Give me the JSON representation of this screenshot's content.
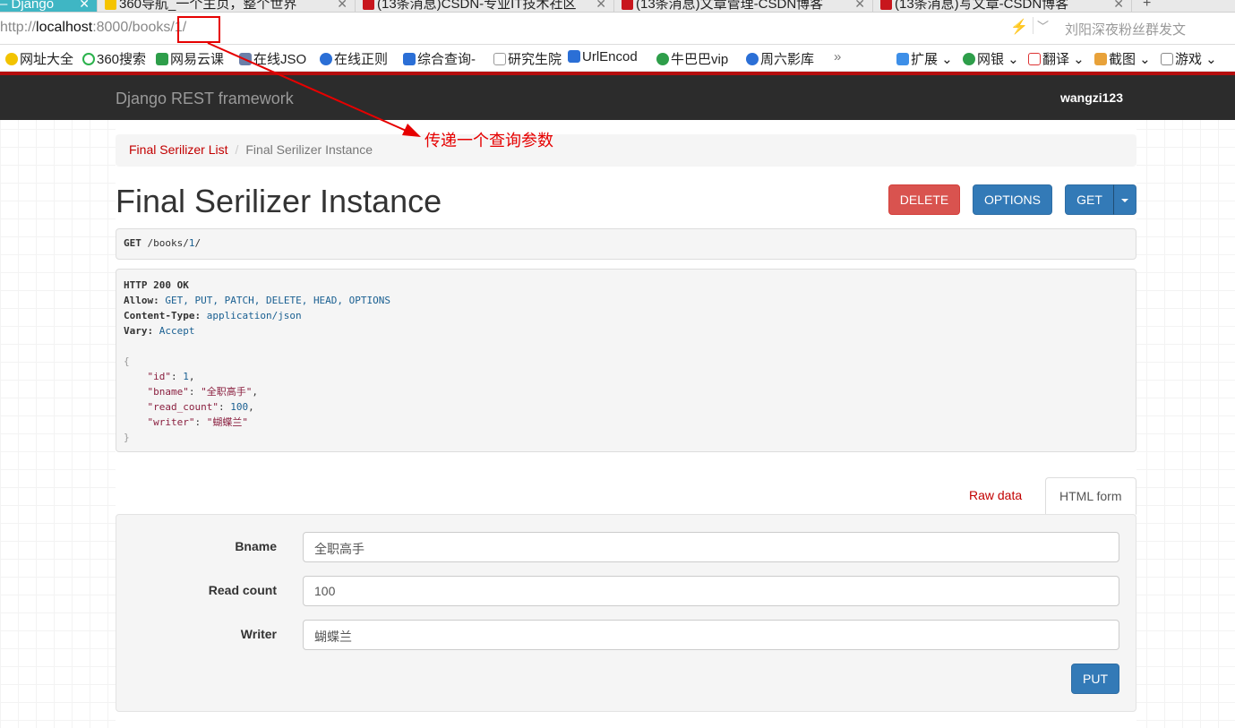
{
  "browser": {
    "tabs": [
      {
        "label": "– Django",
        "active": true
      },
      {
        "label": "360导航_一个主页，整个世界"
      },
      {
        "label": "(13条消息)CSDN-专业IT技术社区"
      },
      {
        "label": "(13条消息)文章管理-CSDN博客"
      },
      {
        "label": "(13条消息)写文章-CSDN博客"
      }
    ],
    "new_tab": "+",
    "url_scheme": "http://",
    "url_host": "localhost",
    "url_rest": ":8000/books/1/",
    "search_hint": "刘阳深夜粉丝群发文",
    "bookmarks": [
      "网址大全",
      "360搜索",
      "网易云课",
      "在线JSO",
      "在线正则",
      "综合查询-",
      "研究生院",
      "UrlEncod",
      "牛巴巴vip",
      "周六影库",
      "»"
    ],
    "toolbar_right": [
      "扩展 ⌄",
      "网银 ⌄",
      "翻译 ⌄",
      "截图 ⌄",
      "游戏 ⌄"
    ]
  },
  "navbar": {
    "brand": "Django REST framework",
    "user": "wangzi123"
  },
  "breadcrumb": {
    "link": "Final Serilizer List",
    "separator": "/",
    "current": "Final Serilizer Instance"
  },
  "page_title": "Final Serilizer Instance",
  "buttons": {
    "delete": "DELETE",
    "options": "OPTIONS",
    "get": "GET",
    "put": "PUT"
  },
  "request": {
    "method": "GET",
    "path_prefix": "/books/",
    "path_id": "1",
    "path_suffix": "/"
  },
  "response": {
    "status": "HTTP 200 OK",
    "headers": [
      {
        "name": "Allow:",
        "value": "GET, PUT, PATCH, DELETE, HEAD, OPTIONS"
      },
      {
        "name": "Content-Type:",
        "value": "application/json"
      },
      {
        "name": "Vary:",
        "value": "Accept"
      }
    ],
    "body": [
      {
        "key": "\"id\"",
        "value": "1",
        "type": "number"
      },
      {
        "key": "\"bname\"",
        "value": "\"全职高手\"",
        "type": "string"
      },
      {
        "key": "\"read_count\"",
        "value": "100",
        "type": "number"
      },
      {
        "key": "\"writer\"",
        "value": "\"蝴蝶兰\"",
        "type": "string"
      }
    ]
  },
  "content_tabs": {
    "raw": "Raw data",
    "html": "HTML form"
  },
  "form": [
    {
      "label": "Bname",
      "value": "全职高手"
    },
    {
      "label": "Read count",
      "value": "100"
    },
    {
      "label": "Writer",
      "value": "蝴蝶兰"
    }
  ],
  "annotation": {
    "text": "传递一个查询参数",
    "color": "#e60000"
  },
  "colors": {
    "navbar": "#2c2c2c",
    "link": "#c20000",
    "primary": "#337ab7",
    "danger": "#d9534f"
  }
}
